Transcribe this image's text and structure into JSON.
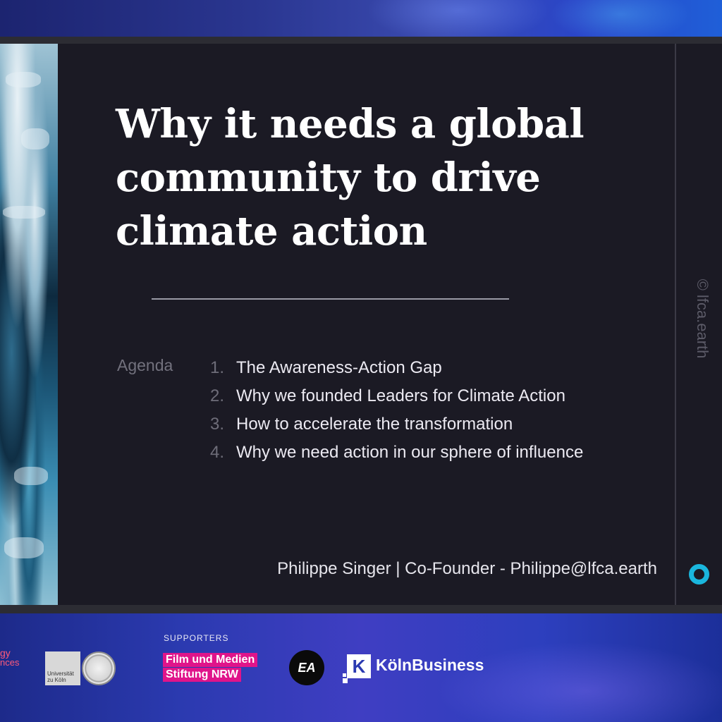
{
  "slide": {
    "title": "Why it needs a global community to drive climate action",
    "agenda_label": "Agenda",
    "agenda": [
      {
        "num": "1.",
        "text": "The Awareness-Action Gap"
      },
      {
        "num": "2.",
        "text": "Why we founded Leaders for Climate Action"
      },
      {
        "num": "3.",
        "text": "How to accelerate the transformation"
      },
      {
        "num": "4.",
        "text": "Why we need action in our sphere of influence"
      }
    ],
    "presenter": "Philippe Singer | Co-Founder - Philippe@lfca.earth",
    "watermark": "© lfca.earth"
  },
  "sponsors": {
    "partner_cut_top": "gy",
    "partner_cut_bottom": "nces",
    "university_text": "Universität zu Köln",
    "supporters_label": "SUPPORTERS",
    "film_medien_line1": "Film und Medien",
    "film_medien_line2": "Stiftung NRW",
    "ea": "EA",
    "koeln_icon_letter": "K",
    "koeln_business": "KölnBusiness"
  },
  "colors": {
    "slide_bg": "#1b1a24",
    "accent_ring": "#1ab6dd",
    "film_medien_pink": "#e0148a",
    "band_blue": "#2b3ab0"
  },
  "icons": {
    "ring_logo": "lfca-ring-icon"
  }
}
